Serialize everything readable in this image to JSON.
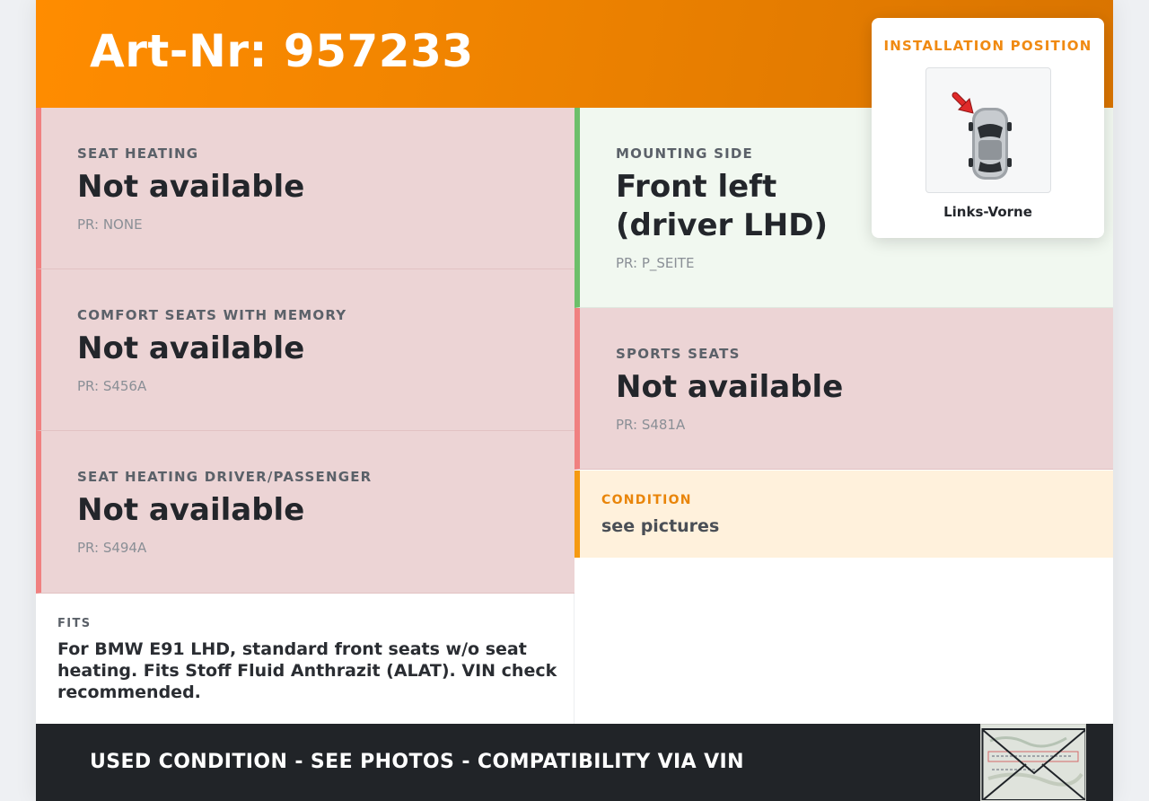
{
  "header": {
    "title": "Art-Nr: 957233"
  },
  "features_left": [
    {
      "label": "SEAT HEATING",
      "value": "Not available",
      "pr": "PR: NONE"
    },
    {
      "label": "COMFORT SEATS WITH MEMORY",
      "value": "Not available",
      "pr": "PR: S456A"
    },
    {
      "label": "SEAT HEATING DRIVER/PASSENGER",
      "value": "Not available",
      "pr": "PR: S494A"
    }
  ],
  "features_right": [
    {
      "label": "MOUNTING SIDE",
      "value": "Front left (driver LHD)",
      "pr": "PR: P_SEITE"
    },
    {
      "label": "SPORTS SEATS",
      "value": "Not available",
      "pr": "PR: S481A"
    }
  ],
  "condition": {
    "label": "CONDITION",
    "value": "see pictures"
  },
  "fits": {
    "label": "FITS",
    "text": "For BMW E91 LHD, standard front seats w/o seat heating. Fits Stoff Fluid Anthrazit (ALAT). VIN check recommended."
  },
  "installation": {
    "title": "INSTALLATION POSITION",
    "caption": "Links-Vorne"
  },
  "footer": {
    "message": "USED CONDITION - SEE PHOTOS - COMPATIBILITY VIA VIN"
  },
  "colors": {
    "accent": "#f08400",
    "unavailable_bg": "#ecd4d5",
    "unavailable_border": "#f08080",
    "available_bg": "#f1f8f0",
    "available_border": "#6cbf6a",
    "condition_bg": "#fff1dc",
    "footer_bg": "#212428"
  }
}
